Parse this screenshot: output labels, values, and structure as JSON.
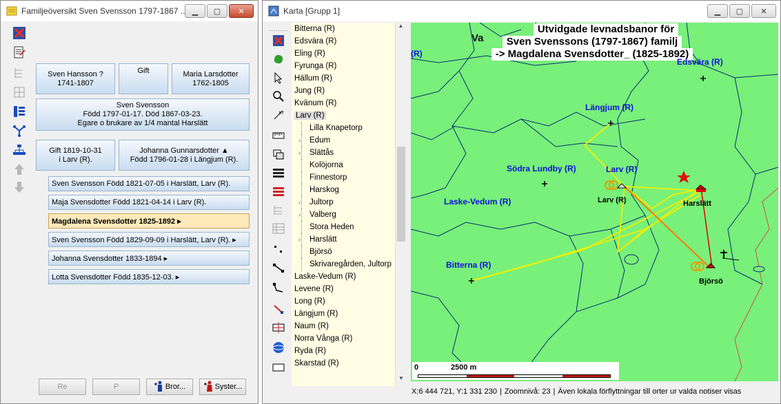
{
  "left_window": {
    "title": "Familjeöversikt Sven Svensson 1797-1867 ...",
    "toolbar_icons": [
      "close-red-x-icon",
      "document-edit-icon",
      "tree-chart-icon",
      "ancestors-icon",
      "list-blue-icon",
      "descendants-icon",
      "hierarchy-icon",
      "up-arrow-icon",
      "down-arrow-icon"
    ],
    "father": {
      "line1": "Sven Hansson ?",
      "line2": "1741-1807"
    },
    "marriage_parents": {
      "line1": "Gift"
    },
    "mother": {
      "line1": "Maria Larsdotter",
      "line2": "1762-1805"
    },
    "main_person": {
      "line1": "Sven Svensson",
      "line2": "Född 1797-01-17. Död 1867-03-23.",
      "line3": "Egare o brukare av 1/4 mantal Harslätt"
    },
    "marriage": {
      "line1": "Gift 1819-10-31",
      "line2": "i Larv (R)."
    },
    "spouse": {
      "line1": "Johanna Gunnarsdotter ▲",
      "line2": "Född 1796-01-28 i Längjum (R)."
    },
    "children": [
      {
        "label": "Sven Svensson Född 1821-07-05 i Harslätt, Larv (R)."
      },
      {
        "label": "Maja Svensdotter Född 1821-04-14 i Larv (R)."
      },
      {
        "label": "Magdalena Svensdotter 1825-1892 ▸"
      },
      {
        "label": "Sven Svensson Född 1829-09-09 i Harslätt, Larv (R). ▸"
      },
      {
        "label": "Johanna Svensdotter 1833-1894 ▸"
      },
      {
        "label": "Lotta Svensdotter Född 1835-12-03. ▸"
      }
    ],
    "selected_child_index": 2,
    "buttons": {
      "re": "Re",
      "p": "P",
      "brother": "Bror...",
      "sister": "Syster..."
    }
  },
  "right_window": {
    "title": "Karta [Grupp 1]",
    "tree_items": [
      {
        "label": "Bitterna (R)",
        "level": 0
      },
      {
        "label": "Edsvära (R)",
        "level": 0
      },
      {
        "label": "Eling (R)",
        "level": 0
      },
      {
        "label": "Fyrunga (R)",
        "level": 0
      },
      {
        "label": "Hällum (R)",
        "level": 0
      },
      {
        "label": "Jung (R)",
        "level": 0
      },
      {
        "label": "Kvänum (R)",
        "level": 0
      },
      {
        "label": "Larv (R)",
        "level": 0
      },
      {
        "label": "Lilla Knapetorp",
        "level": 1
      },
      {
        "label": "Edum",
        "level": 1,
        "expand": true
      },
      {
        "label": "Slättås",
        "level": 1,
        "expand": true
      },
      {
        "label": "Kolöjorna",
        "level": 1
      },
      {
        "label": "Finnestorp",
        "level": 1
      },
      {
        "label": "Harskog",
        "level": 1
      },
      {
        "label": "Jultorp",
        "level": 1,
        "expand": true
      },
      {
        "label": "Valberg",
        "level": 1,
        "expand": true
      },
      {
        "label": "Stora Heden",
        "level": 1
      },
      {
        "label": "Harslätt",
        "level": 1,
        "expand": true
      },
      {
        "label": "Björsö",
        "level": 1
      },
      {
        "label": "Skrivaregården, Jultorp",
        "level": 1
      },
      {
        "label": "Laske-Vedum (R)",
        "level": 0
      },
      {
        "label": "Levene (R)",
        "level": 0
      },
      {
        "label": "Long (R)",
        "level": 0
      },
      {
        "label": "Längjum (R)",
        "level": 0
      },
      {
        "label": "Naum (R)",
        "level": 0
      },
      {
        "label": "Norra Vånga (R)",
        "level": 0
      },
      {
        "label": "Ryda (R)",
        "level": 0
      },
      {
        "label": "Skarstad (R)",
        "level": 0
      }
    ],
    "selected_tree_index": 7,
    "map": {
      "title_line1": "Utvidgade levnadsbanor för",
      "title_line2": "Sven Svenssons  (1797-1867) familj",
      "title_line3": "-> Magdalena Svensdotter_  (1825-1892)",
      "place_labels": [
        "Längjum (R)",
        "Södra Lundby (R)",
        "Larv (R)",
        "Laske-Vedum (R)",
        "Bitterna (R)",
        "Edsvära (R)",
        "(R)",
        "Va"
      ],
      "settlements": [
        "Larv (R)",
        "Harslätt",
        "Björsö"
      ],
      "scale_label": "2500 m",
      "scale_zero": "0"
    },
    "status": {
      "coords": "X:6 444 721, Y:1 331 230",
      "zoom": "Zoomnivå: 23",
      "note": "Även lokala förflyttningar till orter ur valda notiser visas"
    }
  },
  "colors": {
    "map_bg": "#78f07a",
    "tree_bg": "#fffde4",
    "path_yellow": "#f4f000",
    "path_orange": "#ff7a00",
    "path_red": "#e00000",
    "label_blue": "#1010d8",
    "selected_child": "#fde9b8"
  }
}
